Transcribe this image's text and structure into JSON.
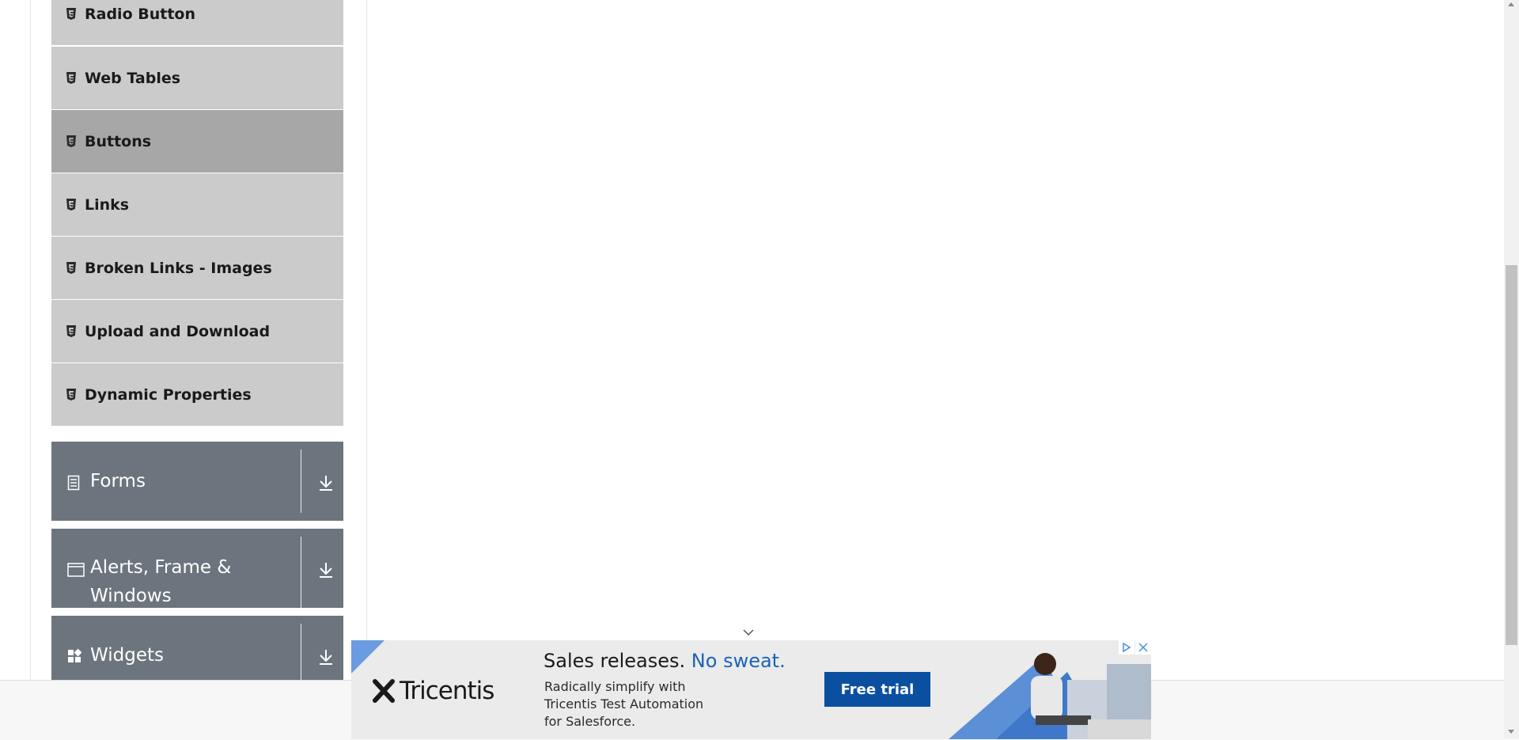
{
  "sidebar": {
    "items": [
      {
        "label": "Radio Button",
        "active": false
      },
      {
        "label": "Web Tables",
        "active": false
      },
      {
        "label": "Buttons",
        "active": true
      },
      {
        "label": "Links",
        "active": false
      },
      {
        "label": "Broken Links - Images",
        "active": false
      },
      {
        "label": "Upload and Download",
        "active": false
      },
      {
        "label": "Dynamic Properties",
        "active": false
      }
    ],
    "item_icon": "html5-icon",
    "groups": [
      {
        "label": "Forms",
        "icon": "form-icon"
      },
      {
        "label_line1": "Alerts, Frame &",
        "label_line2": "Windows",
        "icon": "window-icon"
      },
      {
        "label": "Widgets",
        "icon": "widgets-icon"
      }
    ],
    "group_action_icon": "download-icon"
  },
  "ad": {
    "brand": "Tricentis",
    "headline_part1": "Sales releases.",
    "headline_part2": "No sweat.",
    "body_line1": "Radically simplify with",
    "body_line2": "Tricentis Test Automation",
    "body_line3": "for Salesforce.",
    "cta_label": "Free trial",
    "colors": {
      "cta": "#0b4fa0",
      "accent": "#1d63b8"
    }
  },
  "colors": {
    "menu_item_bg": "#cbcbcb",
    "menu_item_active_bg": "#a7a7a7",
    "group_bg": "#6c757d"
  }
}
